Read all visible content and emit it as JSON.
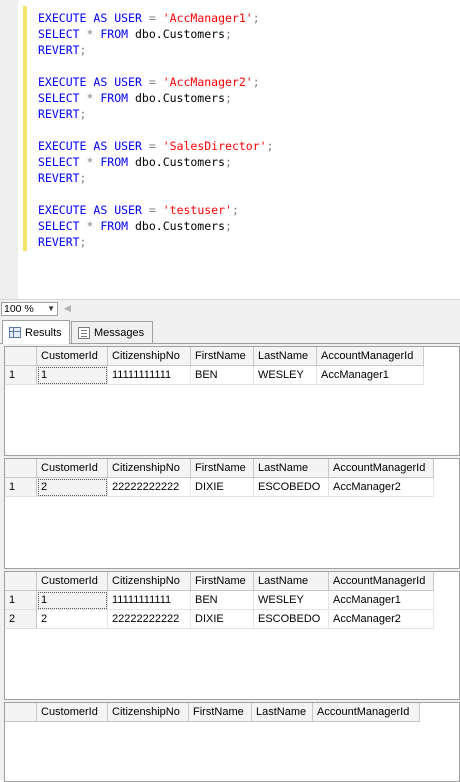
{
  "editor": {
    "lines": [
      {
        "kind": "exec",
        "k1": "EXECUTE",
        "k2": "AS",
        "k3": "USER",
        "op": "=",
        "str": "'AccManager1'",
        "end": ";"
      },
      {
        "kind": "select",
        "k1": "SELECT",
        "op": "*",
        "k2": "FROM",
        "obj": "dbo.Customers",
        "end": ";"
      },
      {
        "kind": "revert",
        "k1": "REVERT",
        "end": ";"
      },
      {
        "kind": "blank"
      },
      {
        "kind": "exec",
        "k1": "EXECUTE",
        "k2": "AS",
        "k3": "USER",
        "op": "=",
        "str": "'AccManager2'",
        "end": ";"
      },
      {
        "kind": "select",
        "k1": "SELECT",
        "op": "*",
        "k2": "FROM",
        "obj": "dbo.Customers",
        "end": ";"
      },
      {
        "kind": "revert",
        "k1": "REVERT",
        "end": ";"
      },
      {
        "kind": "blank"
      },
      {
        "kind": "exec",
        "k1": "EXECUTE",
        "k2": "AS",
        "k3": "USER",
        "op": "=",
        "str": "'SalesDirector'",
        "end": ";"
      },
      {
        "kind": "select",
        "k1": "SELECT",
        "op": "*",
        "k2": "FROM",
        "obj": "dbo.Customers",
        "end": ";"
      },
      {
        "kind": "revert",
        "k1": "REVERT",
        "end": ";"
      },
      {
        "kind": "blank"
      },
      {
        "kind": "exec",
        "k1": "EXECUTE",
        "k2": "AS",
        "k3": "USER",
        "op": "=",
        "str": "'testuser'",
        "end": ";"
      },
      {
        "kind": "select",
        "k1": "SELECT",
        "op": "*",
        "k2": "FROM",
        "obj": "dbo.Customers",
        "end": ";"
      },
      {
        "kind": "revert",
        "k1": "REVERT",
        "end": ";"
      }
    ],
    "colors": {
      "keyword": "#0000ff",
      "string": "#ff0000",
      "operator": "#808080"
    }
  },
  "zoom": {
    "value": "100 %"
  },
  "tabs": {
    "results": "Results",
    "messages": "Messages"
  },
  "result_sets": [
    {
      "columns": [
        "CustomerId",
        "CitizenshipNo",
        "FirstName",
        "LastName",
        "AccountManagerId"
      ],
      "rows": [
        {
          "n": "1",
          "cells": [
            "1",
            "11111111111",
            "BEN",
            "WESLEY",
            "AccManager1"
          ]
        }
      ]
    },
    {
      "columns": [
        "CustomerId",
        "CitizenshipNo",
        "FirstName",
        "LastName",
        "AccountManagerId"
      ],
      "rows": [
        {
          "n": "1",
          "cells": [
            "2",
            "22222222222",
            "DIXIE",
            "ESCOBEDO",
            "AccManager2"
          ]
        }
      ]
    },
    {
      "columns": [
        "CustomerId",
        "CitizenshipNo",
        "FirstName",
        "LastName",
        "AccountManagerId"
      ],
      "rows": [
        {
          "n": "1",
          "cells": [
            "1",
            "11111111111",
            "BEN",
            "WESLEY",
            "AccManager1"
          ]
        },
        {
          "n": "2",
          "cells": [
            "2",
            "22222222222",
            "DIXIE",
            "ESCOBEDO",
            "AccManager2"
          ]
        }
      ]
    },
    {
      "columns": [
        "CustomerId",
        "CitizenshipNo",
        "FirstName",
        "LastName",
        "AccountManagerId"
      ],
      "rows": []
    }
  ]
}
